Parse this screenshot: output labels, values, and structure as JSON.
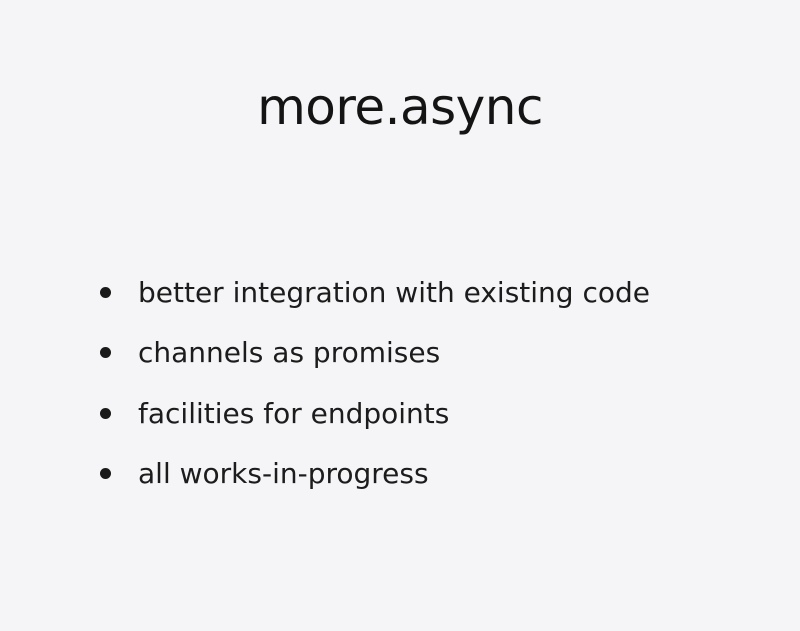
{
  "slide": {
    "title": "more.async",
    "bullets": [
      {
        "text": "better integration with existing code"
      },
      {
        "text": "channels as promises"
      },
      {
        "text": "facilities for endpoints"
      },
      {
        "text": "all works-in-progress"
      }
    ]
  }
}
